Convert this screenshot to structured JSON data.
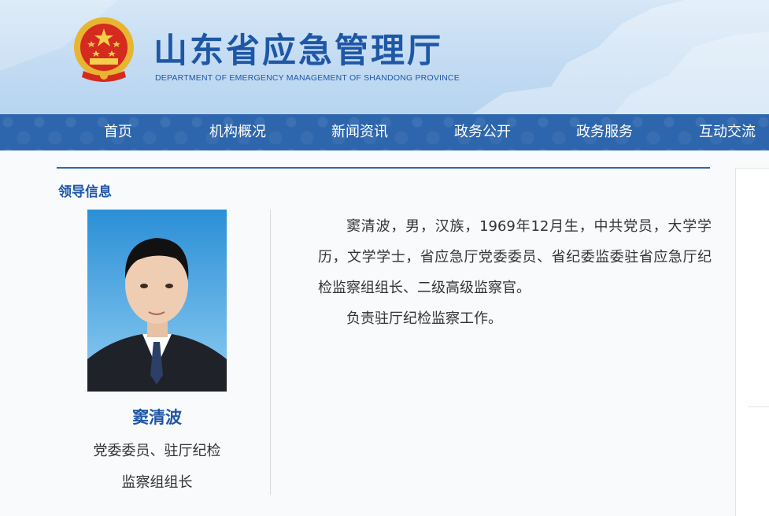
{
  "header": {
    "site_title": "山东省应急管理厅",
    "site_subtitle": "DEPARTMENT OF EMERGENCY MANAGEMENT OF SHANDONG PROVINCE",
    "emblem_icon": "national-emblem-icon"
  },
  "nav": {
    "items": [
      {
        "label": "首页"
      },
      {
        "label": "机构概况"
      },
      {
        "label": "新闻资讯"
      },
      {
        "label": "政务公开"
      },
      {
        "label": "政务服务"
      },
      {
        "label": "互动交流"
      }
    ]
  },
  "section": {
    "title": "领导信息"
  },
  "leader": {
    "name": "窦清波",
    "title_line1": "党委委员、驻厅纪检",
    "title_line2": "监察组组长",
    "bio_paragraph1": "窦清波，男，汉族，1969年12月生，中共党员，大学学历，文学学士，省应急厅党委委员、省纪委监委驻省应急厅纪检监察组组长、二级高级监察官。",
    "bio_paragraph2": "负责驻厅纪检监察工作。"
  },
  "colors": {
    "brand_blue": "#1f57a7",
    "nav_blue": "#2d66ad",
    "banner_light": "#c6ddf3"
  }
}
